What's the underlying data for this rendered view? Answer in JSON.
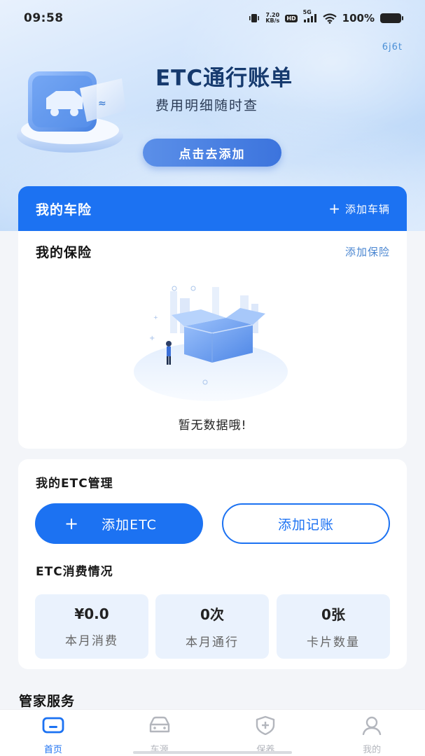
{
  "status_bar": {
    "time": "09:58",
    "net_speed_value": "7.20",
    "net_speed_unit": "KB/s",
    "hd_badge": "HD",
    "network": "5G",
    "battery": "100%"
  },
  "hero": {
    "corner_code": "6j6t",
    "title": "ETC通行账单",
    "subtitle": "费用明细随时查",
    "button_label": "点击去添加",
    "icon": "etc-card-icon"
  },
  "car_insurance": {
    "header_title": "我的车险",
    "add_vehicle_label": "添加车辆",
    "my_insurance_title": "我的保险",
    "add_insurance_label": "添加保险",
    "empty_text": "暂无数据哦!"
  },
  "etc_management": {
    "title": "我的ETC管理",
    "add_etc_label": "添加ETC",
    "add_record_label": "添加记账",
    "consumption_title": "ETC消费情况",
    "stats": [
      {
        "value": "¥0.0",
        "label": "本月消费"
      },
      {
        "value": "0次",
        "label": "本月通行"
      },
      {
        "value": "0张",
        "label": "卡片数量"
      }
    ]
  },
  "steward": {
    "title": "管家服务"
  },
  "bottom_nav": [
    {
      "label": "首页",
      "icon": "home-icon",
      "active": true
    },
    {
      "label": "车源",
      "icon": "car-icon",
      "active": false
    },
    {
      "label": "保养",
      "icon": "shield-plus-icon",
      "active": false
    },
    {
      "label": "我的",
      "icon": "user-icon",
      "active": false
    }
  ],
  "colors": {
    "primary": "#1c72f2",
    "active_nav": "#1c72f2",
    "inactive_nav": "#b3b6bd",
    "stat_bg": "#eaf2fd"
  }
}
